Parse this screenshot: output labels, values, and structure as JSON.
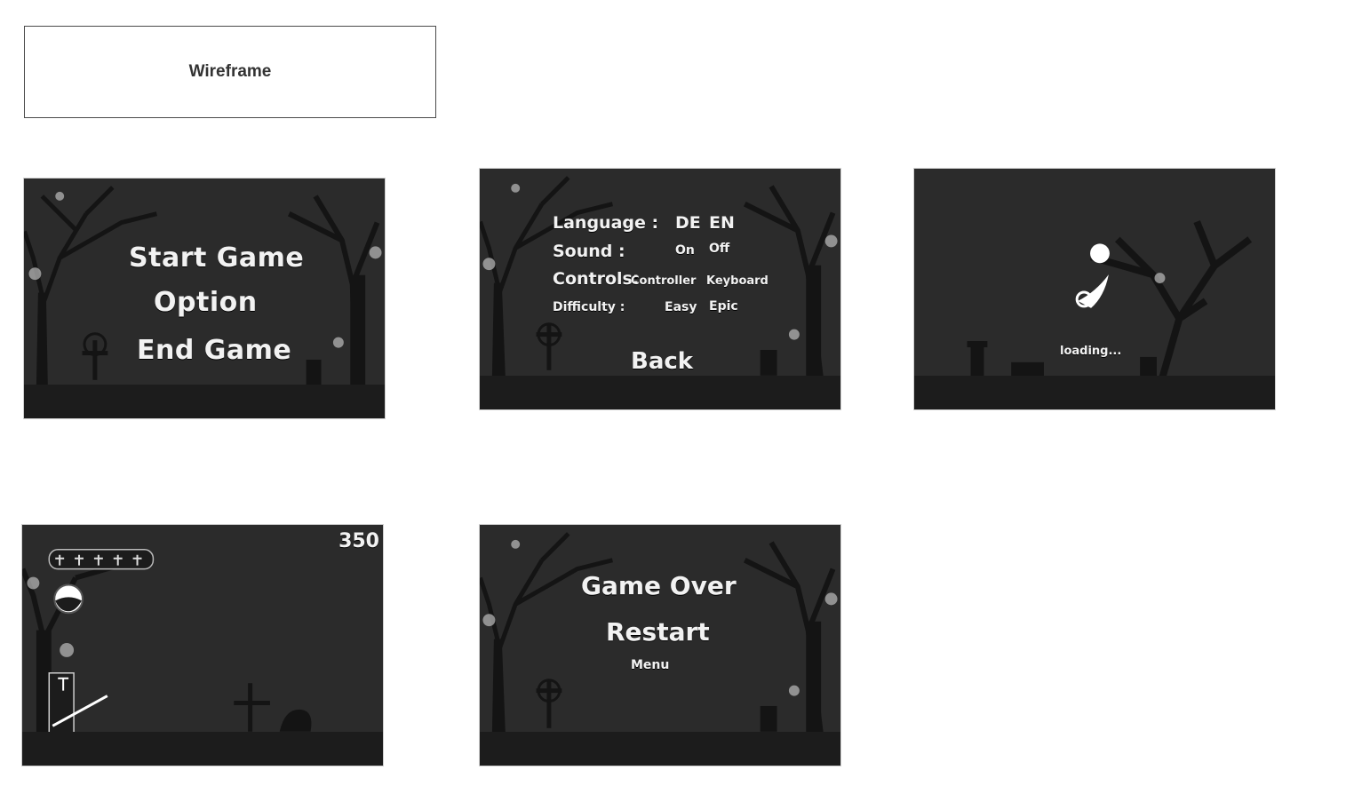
{
  "header": {
    "title": "Wireframe"
  },
  "main_menu": {
    "start": "Start Game",
    "option": "Option",
    "end": "End Game"
  },
  "options": {
    "language_label": "Language :",
    "lang_de": "DE",
    "lang_en": "EN",
    "sound_label": "Sound :",
    "sound_on": "On",
    "sound_off": "Off",
    "controls_label": "Controls:",
    "controls_controller": "Controller",
    "controls_keyboard": "Keyboard",
    "difficulty_label": "Difficulty :",
    "difficulty_easy": "Easy",
    "difficulty_epic": "Epic",
    "back": "Back"
  },
  "loading": {
    "text": "loading..."
  },
  "gameplay": {
    "score": "350"
  },
  "game_over": {
    "title": "Game Over",
    "restart": "Restart",
    "menu": "Menu"
  }
}
